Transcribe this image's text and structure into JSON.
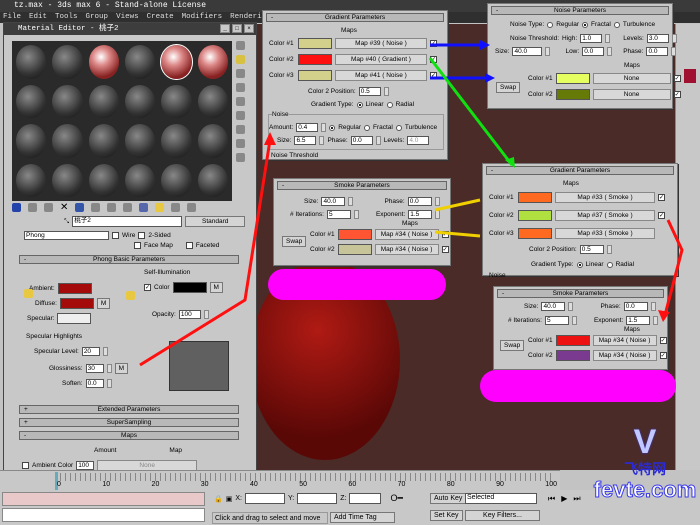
{
  "app": {
    "title": "tz.max - 3ds max 6 - Stand-alone License",
    "menu": [
      "File",
      "Edit",
      "Tools",
      "Group",
      "Views",
      "Create",
      "Modifiers",
      "Rendering"
    ]
  },
  "material_editor": {
    "title": "Material Editor - 桃子2",
    "material_name": "桃子2",
    "material_type": "Standard",
    "shader": "Phong",
    "wire_label": "Wire",
    "two_sided_label": "2-Sided",
    "face_map_label": "Face Map",
    "faceted_label": "Faceted",
    "basic": {
      "header": "Phong Basic Parameters",
      "ambient_label": "Ambient:",
      "diffuse_label": "Diffuse:",
      "specular_label": "Specular:",
      "ambient_color": "#a50a0a",
      "diffuse_color": "#a50a0a",
      "specular_color": "#eeeeee",
      "m_label": "M",
      "self_illum_label": "Self-Illumination",
      "color_label": "Color",
      "self_illum_color": "#000000",
      "opacity_label": "Opacity:",
      "opacity": "100"
    },
    "specular": {
      "header": "Specular Highlights",
      "level_label": "Specular Level:",
      "level": "20",
      "gloss_label": "Glossiness:",
      "gloss": "30",
      "soften_label": "Soften:",
      "soften": "0.0"
    },
    "rollouts": [
      {
        "sign": "+",
        "label": "Extended Parameters"
      },
      {
        "sign": "+",
        "label": "SuperSampling"
      },
      {
        "sign": "-",
        "label": "Maps"
      }
    ],
    "maps": {
      "amount_header": "Amount",
      "map_header": "Map",
      "ambient_label": "Ambient Color",
      "ambient_amount": "100",
      "ambient_map": "None"
    }
  },
  "gradient1": {
    "header": "Gradient Parameters",
    "maps_label": "Maps",
    "colors": [
      {
        "label": "Color #1",
        "hex": "#d2d08a",
        "map": "Map #39  ( Noise )"
      },
      {
        "label": "Color #2",
        "hex": "#ff1010",
        "map": "Map #40  ( Gradient )"
      },
      {
        "label": "Color #3",
        "hex": "#d2d08a",
        "map": "Map #41  ( Noise )"
      }
    ],
    "pos_label": "Color 2 Position:",
    "pos": "0.5",
    "type_label": "Gradient Type:",
    "type_options": [
      "Linear",
      "Radial"
    ],
    "noise": {
      "label": "Noise",
      "amount_label": "Amount:",
      "amount": "0.4",
      "types": [
        "Regular",
        "Fractal",
        "Turbulence"
      ],
      "size_label": "Size:",
      "size": "6.5",
      "phase_label": "Phase:",
      "phase": "0.0",
      "levels_label": "Levels:",
      "levels": "4.0",
      "threshold_label": "Noise Threshold"
    }
  },
  "noise_panel": {
    "header": "Noise Parameters",
    "type_label": "Noise Type:",
    "types": [
      "Regular",
      "Fractal",
      "Turbulence"
    ],
    "threshold_label": "Noise Threshold:",
    "high_label": "High:",
    "high": "1.0",
    "levels_label": "Levels:",
    "levels": "3.0",
    "size_label": "Size:",
    "size": "40.0",
    "low_label": "Low:",
    "low": "0.0",
    "phase_label": "Phase:",
    "phase": "0.0",
    "maps_label": "Maps",
    "swap": "Swap",
    "colors": [
      {
        "label": "Color #1",
        "hex": "#e6ff60",
        "map": "None"
      },
      {
        "label": "Color #2",
        "hex": "#667a08",
        "map": "None"
      }
    ]
  },
  "smoke1": {
    "header": "Smoke Parameters",
    "size_label": "Size:",
    "size": "40.0",
    "phase_label": "Phase:",
    "phase": "0.0",
    "iter_label": "# Iterations:",
    "iter": "5",
    "exp_label": "Exponent:",
    "exp": "1.5",
    "maps_label": "Maps",
    "swap": "Swap",
    "colors": [
      {
        "label": "Color #1",
        "hex": "#ff5533",
        "map": "Map #34  ( Noise )"
      },
      {
        "label": "Color #2",
        "hex": "#c8c49a",
        "map": "Map #34  ( Noise )"
      }
    ]
  },
  "gradient2": {
    "header": "Gradient Parameters",
    "maps_label": "Maps",
    "colors": [
      {
        "label": "Color #1",
        "hex": "#ff6a20",
        "map": "Map #33  ( Smoke )"
      },
      {
        "label": "Color #2",
        "hex": "#b0e040",
        "map": "Map #37  ( Smoke )"
      },
      {
        "label": "Color #3",
        "hex": "#ff6a20",
        "map": "Map #33  ( Smoke )"
      }
    ],
    "pos_label": "Color 2 Position:",
    "pos": "0.5",
    "type_label": "Gradient Type:",
    "type_options": [
      "Linear",
      "Radial"
    ],
    "noise_label": "Noise"
  },
  "smoke2": {
    "header": "Smoke Parameters",
    "size_label": "Size:",
    "size": "40.0",
    "phase_label": "Phase:",
    "phase": "0.0",
    "iter_label": "# Iterations:",
    "iter": "5",
    "exp_label": "Exponent:",
    "exp": "1.5",
    "maps_label": "Maps",
    "swap": "Swap",
    "colors": [
      {
        "label": "Color #1",
        "hex": "#ee1111",
        "map": "Map #34  ( Noise )"
      },
      {
        "label": "Color #2",
        "hex": "#7a3a90",
        "map": "Map #34  ( Noise )"
      }
    ]
  },
  "timeline": {
    "ticks": [
      "0",
      "10",
      "20",
      "30",
      "40",
      "50",
      "60",
      "70",
      "80",
      "90",
      "100"
    ]
  },
  "statusbar": {
    "x_label": "X:",
    "y_label": "Y:",
    "z_label": "Z:",
    "prompt": "Click and drag to select and move",
    "add_time_tag": "Add Time Tag",
    "auto_key": "Auto Key",
    "set_key": "Set Key",
    "selected": "Selected",
    "key_filters": "Key Filters..."
  },
  "watermark": {
    "brand_cn": "飞特网",
    "brand": "fevte.com"
  }
}
